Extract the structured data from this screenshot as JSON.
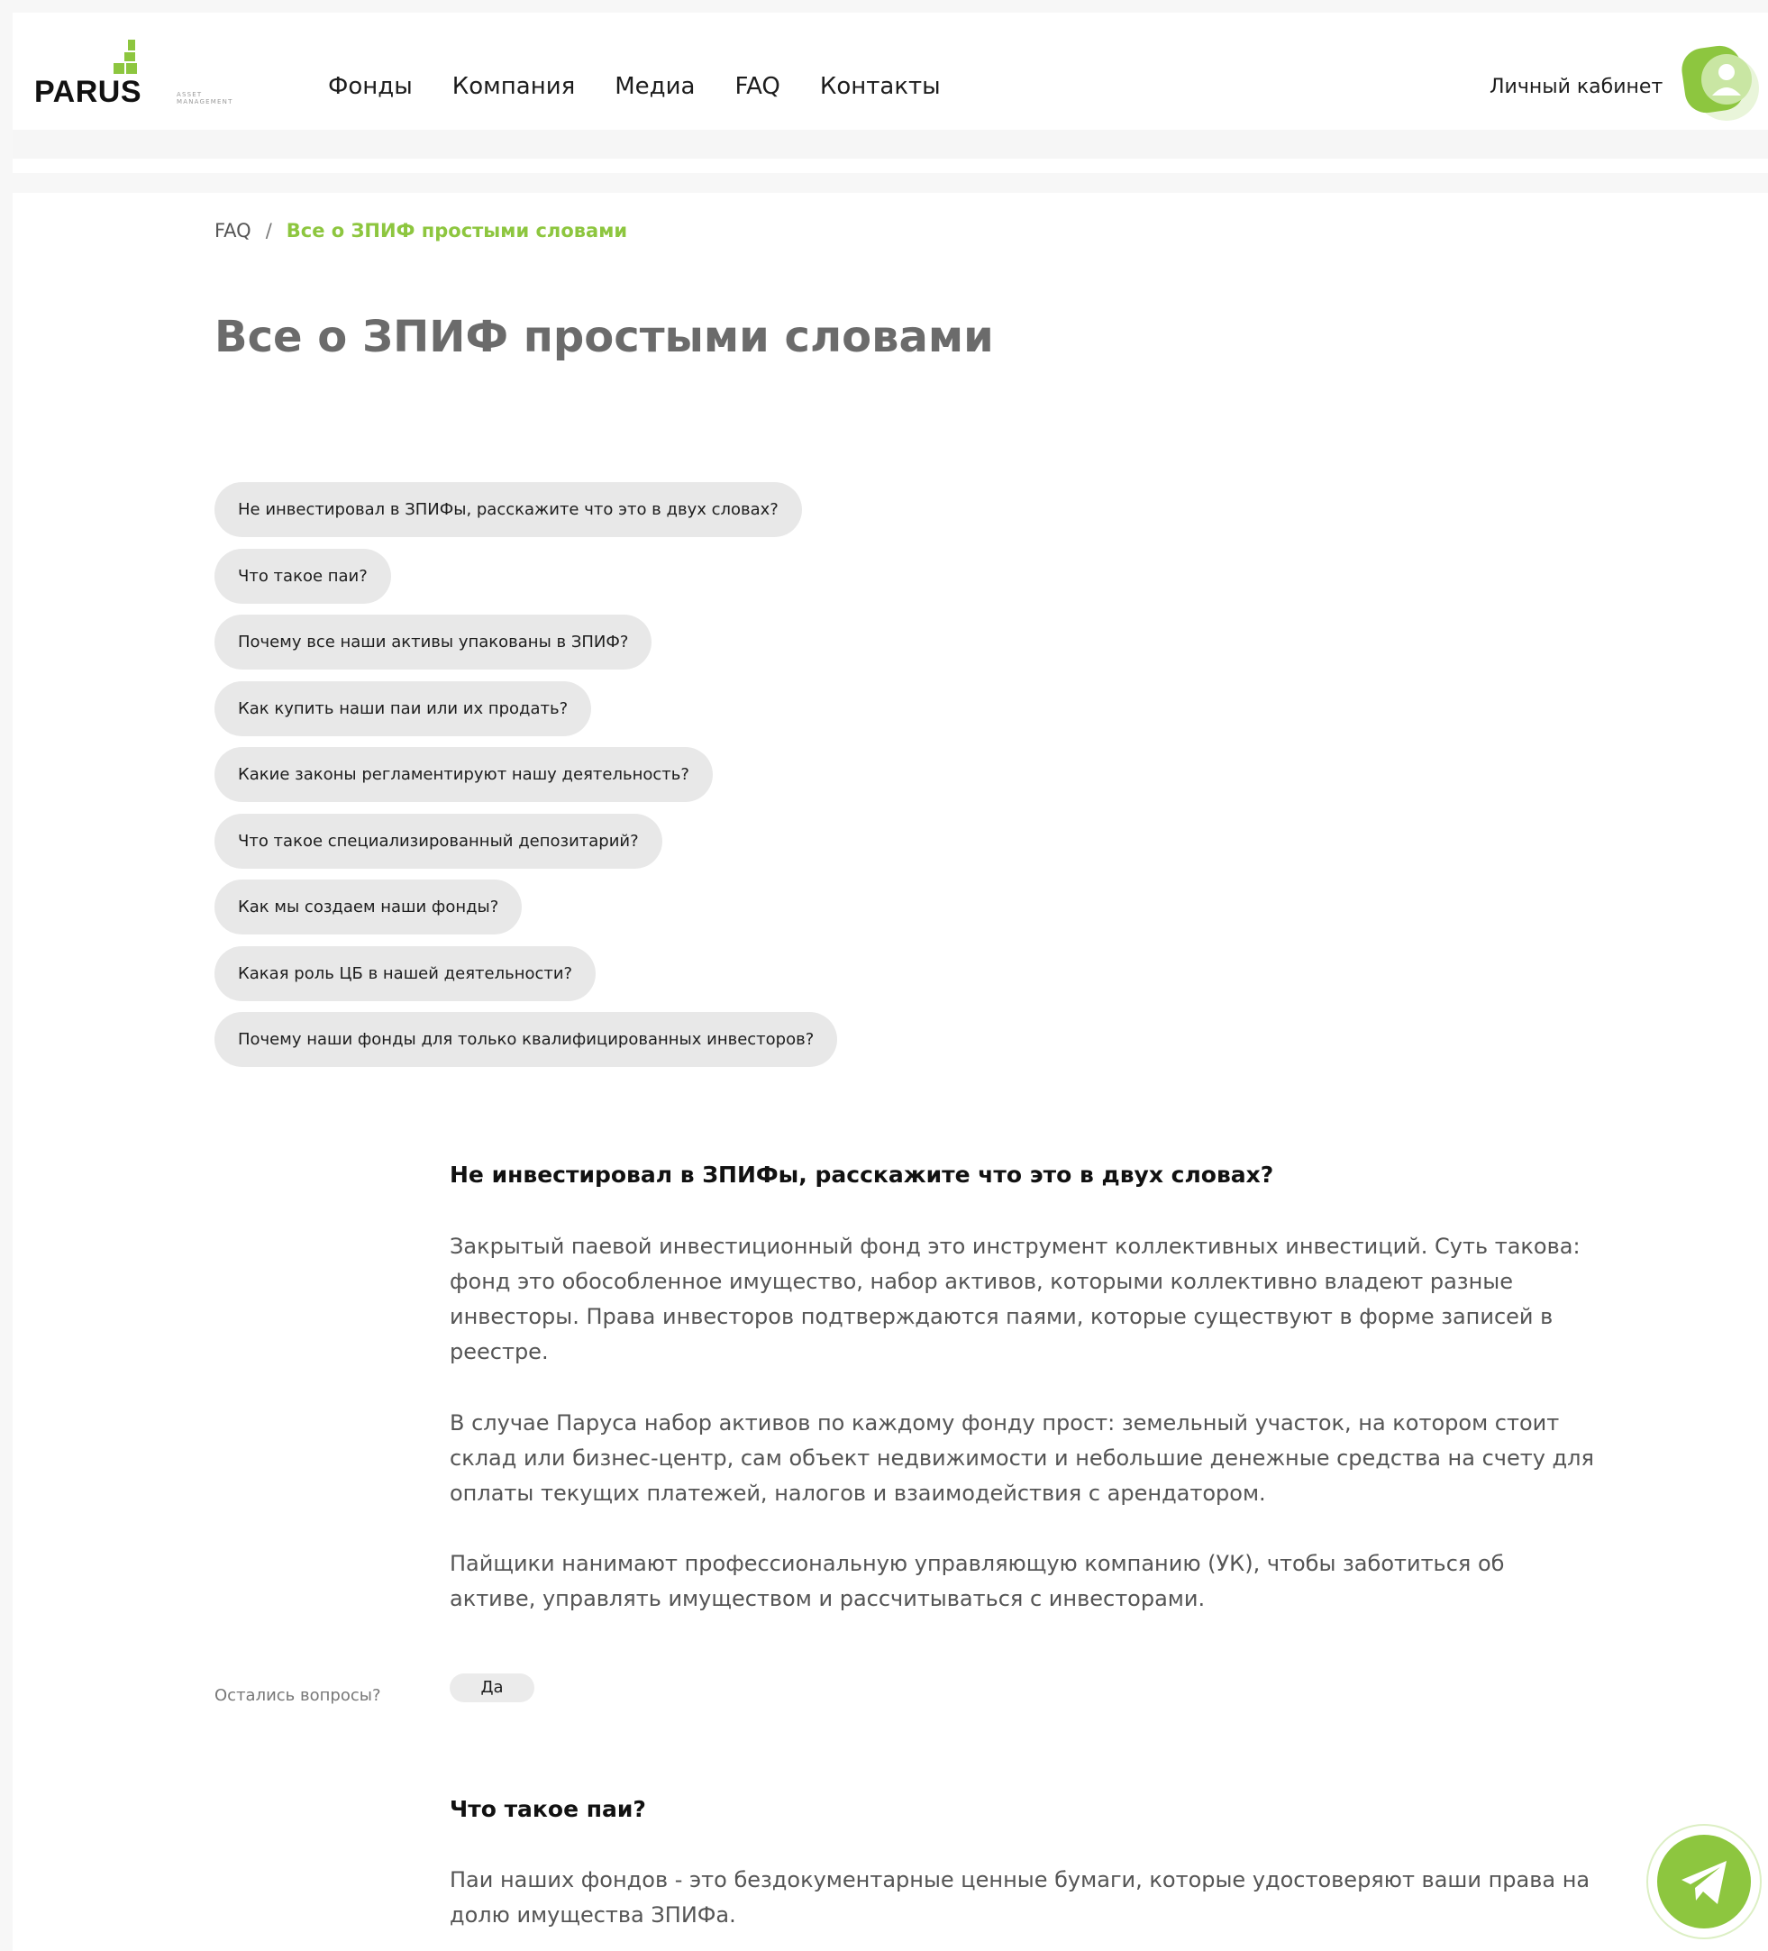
{
  "header": {
    "logo_text": "PARUS",
    "logo_sub": [
      "ASSET",
      "MANAGEMENT"
    ],
    "nav": [
      {
        "label": "Фонды"
      },
      {
        "label": "Компания"
      },
      {
        "label": "Медиа"
      },
      {
        "label": "FAQ"
      },
      {
        "label": "Контакты"
      }
    ],
    "account_label": "Личный кабинет",
    "avatar_icon": "user-icon"
  },
  "breadcrumb": {
    "root": "FAQ",
    "separator": "/",
    "current": "Все о ЗПИФ простыми словами"
  },
  "page_title": "Все о ЗПИФ простыми словами",
  "questions": [
    {
      "label": "Не инвестировал в ЗПИФы, расскажите что это в двух словах?"
    },
    {
      "label": "Что такое паи?"
    },
    {
      "label": "Почему все наши активы упакованы в ЗПИФ?"
    },
    {
      "label": "Как купить наши паи или их продать?"
    },
    {
      "label": "Какие законы регламентируют нашу деятельность?"
    },
    {
      "label": "Что такое специализированный депозитарий?"
    },
    {
      "label": "Как мы создаем наши фонды?"
    },
    {
      "label": "Какая роль ЦБ в нашей деятельности?"
    },
    {
      "label": "Почему наши фонды для только квалифицированных инвесторов?"
    }
  ],
  "answers": [
    {
      "title": "Не инвестировал в ЗПИФы, расскажите что это в двух словах?",
      "paragraphs": [
        "Закрытый паевой инвестиционный фонд это инструмент коллективных инвестиций. Суть такова: фонд это обособленное имущество, набор активов, которыми коллективно владеют разные инвесторы. Права инвесторов подтверждаются паями, которые существуют в форме записей в реестре.",
        "В случае Паруса набор активов по каждому фонду прост: земельный участок, на котором стоит склад или бизнес-центр, сам объект недвижимости и небольшие денежные средства на счету для оплаты текущих платежей, налогов и взаимодействия с арендатором.",
        "Пайщики нанимают профессиональную управляющую компанию (УК), чтобы заботиться об активе, управлять имуществом и рассчитываться с инвесторами."
      ]
    },
    {
      "title": "Что такое паи?",
      "paragraphs": [
        "Паи наших фондов - это бездокументарные ценные бумаги, которые удостоверяют ваши права на долю имущества ЗПИФа."
      ]
    }
  ],
  "feedback": {
    "label": "Остались вопросы?",
    "yes": "Да"
  },
  "floating": {
    "icon": "telegram-icon"
  },
  "colors": {
    "accent": "#8dc63f",
    "pill_bg": "#e8e8e8",
    "title_gray": "#6b6b6b"
  }
}
